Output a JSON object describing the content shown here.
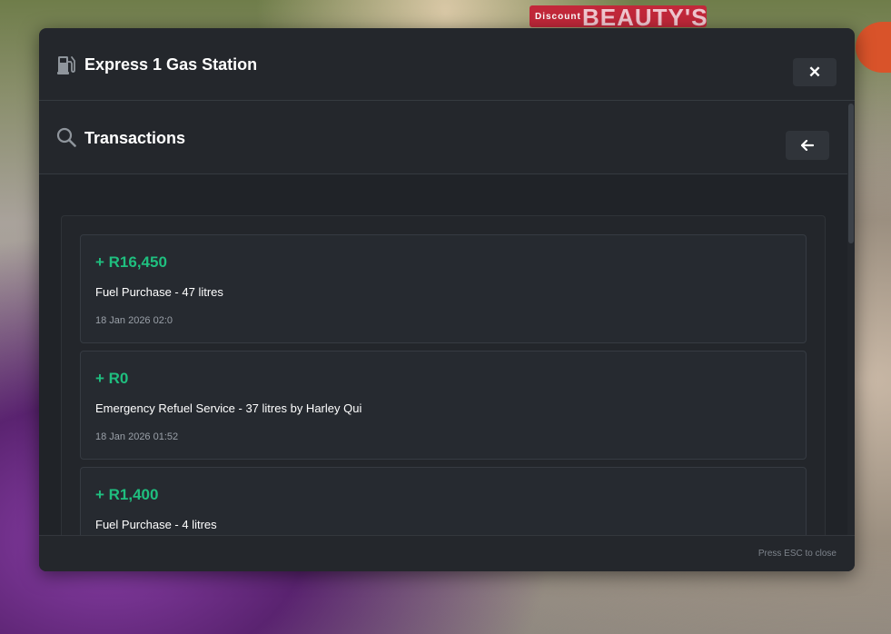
{
  "background": {
    "sign_small": "Discount",
    "sign_text": "BEAUTY'S"
  },
  "window": {
    "title": "Express 1 Gas Station",
    "title_icon": "gas-pump-icon",
    "close_label": "✕"
  },
  "subheader": {
    "title": "Transactions",
    "icon": "search-icon",
    "back_icon": "arrow-left-icon"
  },
  "transactions": [
    {
      "amount": "+ R16,450",
      "description": "Fuel Purchase - 47 litres",
      "date": "18 Jan 2026 02:0"
    },
    {
      "amount": "+ R0",
      "description": "Emergency Refuel Service - 37 litres by Harley Qui",
      "date": "18 Jan 2026 01:52"
    },
    {
      "amount": "+ R1,400",
      "description": "Fuel Purchase - 4 litres",
      "date": ""
    }
  ],
  "footer": {
    "hint": "Press ESC to close"
  },
  "colors": {
    "accent_green": "#1fbf7f",
    "modal_bg": "#24272c",
    "card_bg": "#262a30"
  }
}
